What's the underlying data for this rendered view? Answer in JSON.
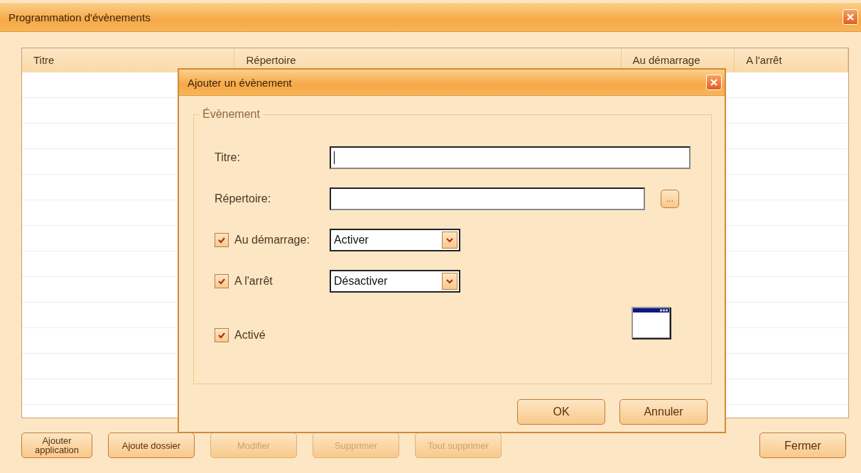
{
  "window": {
    "title": "Programmation d'évènements"
  },
  "table": {
    "columns": [
      "Titre",
      "Répertoire",
      "Au démarrage",
      "A l'arrêt"
    ]
  },
  "buttons": [
    {
      "label": "Ajouter application",
      "disabled": false
    },
    {
      "label": "Ajoute dossier",
      "disabled": false
    },
    {
      "label": "Modifier",
      "disabled": true
    },
    {
      "label": "Supprimer",
      "disabled": true
    },
    {
      "label": "Tout supprimer",
      "disabled": true
    },
    {
      "label": "Fermer",
      "disabled": false
    }
  ],
  "dialog": {
    "title": "Ajouter un évènement",
    "group": "Évènement",
    "fields": [
      {
        "kind": "text",
        "label": "Titre:",
        "focused": true
      },
      {
        "kind": "browse",
        "label": "Répertoire:",
        "button": "..."
      },
      {
        "kind": "select",
        "label": "Au démarrage:",
        "checked": true,
        "value": "Activer"
      },
      {
        "kind": "select",
        "label": "A l'arrêt",
        "checked": true,
        "value": "Désactiver"
      },
      {
        "kind": "check",
        "label": "Activé",
        "checked": true
      }
    ],
    "buttons": [
      "OK",
      "Annuler"
    ]
  }
}
